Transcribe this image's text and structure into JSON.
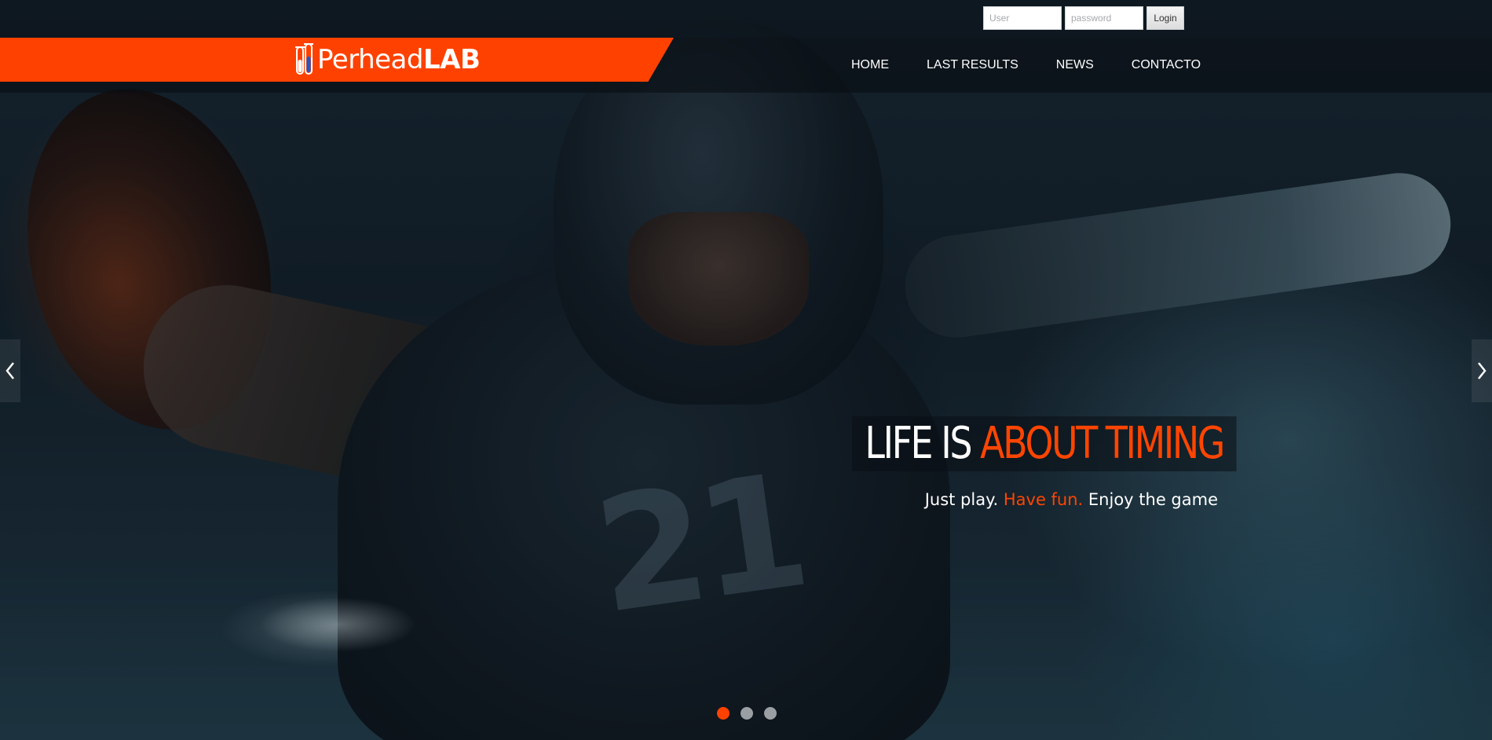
{
  "login": {
    "user_placeholder": "User",
    "password_placeholder": "password",
    "button_label": "Login"
  },
  "brand": {
    "name_light": "Perhead",
    "name_bold": "LAB",
    "icon": "test-tubes-icon",
    "strip_color": "#ff4100"
  },
  "nav": {
    "items": [
      {
        "label": "HOME"
      },
      {
        "label": "LAST RESULTS"
      },
      {
        "label": "NEWS"
      },
      {
        "label": "CONTACTO"
      }
    ]
  },
  "hero": {
    "title_plain": "LIFE IS ",
    "title_accent": "ABOUT TIMING",
    "subtitle_part1": "Just play. ",
    "subtitle_accent": "Have fun.",
    "subtitle_part2": " Enjoy the game",
    "accent_color": "#ff4500",
    "jersey_number": "21"
  },
  "carousel": {
    "prev_icon": "chevron-left-icon",
    "next_icon": "chevron-right-icon",
    "slides": 3,
    "active_index": 0
  }
}
